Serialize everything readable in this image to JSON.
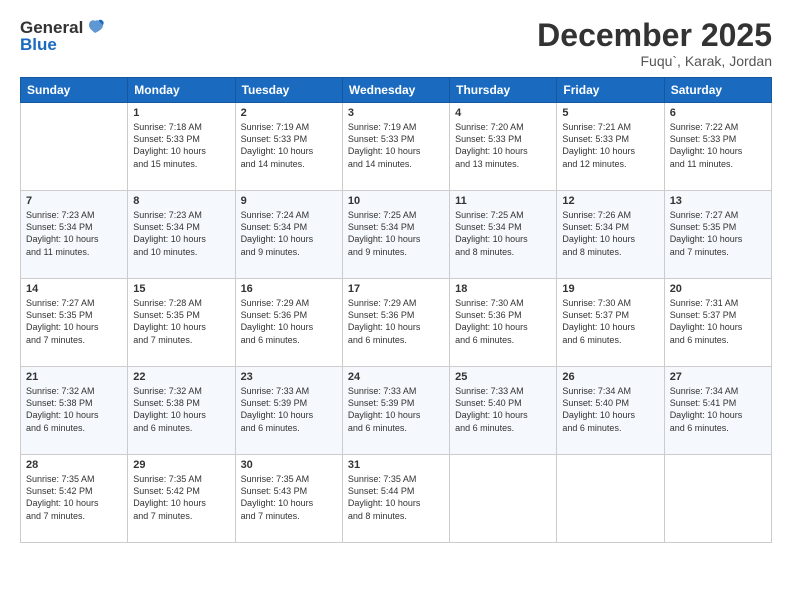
{
  "logo": {
    "line1": "General",
    "line2": "Blue"
  },
  "header": {
    "month": "December 2025",
    "location": "Fuqu`, Karak, Jordan"
  },
  "weekdays": [
    "Sunday",
    "Monday",
    "Tuesday",
    "Wednesday",
    "Thursday",
    "Friday",
    "Saturday"
  ],
  "weeks": [
    [
      {
        "day": "",
        "content": ""
      },
      {
        "day": "1",
        "content": "Sunrise: 7:18 AM\nSunset: 5:33 PM\nDaylight: 10 hours\nand 15 minutes."
      },
      {
        "day": "2",
        "content": "Sunrise: 7:19 AM\nSunset: 5:33 PM\nDaylight: 10 hours\nand 14 minutes."
      },
      {
        "day": "3",
        "content": "Sunrise: 7:19 AM\nSunset: 5:33 PM\nDaylight: 10 hours\nand 14 minutes."
      },
      {
        "day": "4",
        "content": "Sunrise: 7:20 AM\nSunset: 5:33 PM\nDaylight: 10 hours\nand 13 minutes."
      },
      {
        "day": "5",
        "content": "Sunrise: 7:21 AM\nSunset: 5:33 PM\nDaylight: 10 hours\nand 12 minutes."
      },
      {
        "day": "6",
        "content": "Sunrise: 7:22 AM\nSunset: 5:33 PM\nDaylight: 10 hours\nand 11 minutes."
      }
    ],
    [
      {
        "day": "7",
        "content": "Sunrise: 7:23 AM\nSunset: 5:34 PM\nDaylight: 10 hours\nand 11 minutes."
      },
      {
        "day": "8",
        "content": "Sunrise: 7:23 AM\nSunset: 5:34 PM\nDaylight: 10 hours\nand 10 minutes."
      },
      {
        "day": "9",
        "content": "Sunrise: 7:24 AM\nSunset: 5:34 PM\nDaylight: 10 hours\nand 9 minutes."
      },
      {
        "day": "10",
        "content": "Sunrise: 7:25 AM\nSunset: 5:34 PM\nDaylight: 10 hours\nand 9 minutes."
      },
      {
        "day": "11",
        "content": "Sunrise: 7:25 AM\nSunset: 5:34 PM\nDaylight: 10 hours\nand 8 minutes."
      },
      {
        "day": "12",
        "content": "Sunrise: 7:26 AM\nSunset: 5:34 PM\nDaylight: 10 hours\nand 8 minutes."
      },
      {
        "day": "13",
        "content": "Sunrise: 7:27 AM\nSunset: 5:35 PM\nDaylight: 10 hours\nand 7 minutes."
      }
    ],
    [
      {
        "day": "14",
        "content": "Sunrise: 7:27 AM\nSunset: 5:35 PM\nDaylight: 10 hours\nand 7 minutes."
      },
      {
        "day": "15",
        "content": "Sunrise: 7:28 AM\nSunset: 5:35 PM\nDaylight: 10 hours\nand 7 minutes."
      },
      {
        "day": "16",
        "content": "Sunrise: 7:29 AM\nSunset: 5:36 PM\nDaylight: 10 hours\nand 6 minutes."
      },
      {
        "day": "17",
        "content": "Sunrise: 7:29 AM\nSunset: 5:36 PM\nDaylight: 10 hours\nand 6 minutes."
      },
      {
        "day": "18",
        "content": "Sunrise: 7:30 AM\nSunset: 5:36 PM\nDaylight: 10 hours\nand 6 minutes."
      },
      {
        "day": "19",
        "content": "Sunrise: 7:30 AM\nSunset: 5:37 PM\nDaylight: 10 hours\nand 6 minutes."
      },
      {
        "day": "20",
        "content": "Sunrise: 7:31 AM\nSunset: 5:37 PM\nDaylight: 10 hours\nand 6 minutes."
      }
    ],
    [
      {
        "day": "21",
        "content": "Sunrise: 7:32 AM\nSunset: 5:38 PM\nDaylight: 10 hours\nand 6 minutes."
      },
      {
        "day": "22",
        "content": "Sunrise: 7:32 AM\nSunset: 5:38 PM\nDaylight: 10 hours\nand 6 minutes."
      },
      {
        "day": "23",
        "content": "Sunrise: 7:33 AM\nSunset: 5:39 PM\nDaylight: 10 hours\nand 6 minutes."
      },
      {
        "day": "24",
        "content": "Sunrise: 7:33 AM\nSunset: 5:39 PM\nDaylight: 10 hours\nand 6 minutes."
      },
      {
        "day": "25",
        "content": "Sunrise: 7:33 AM\nSunset: 5:40 PM\nDaylight: 10 hours\nand 6 minutes."
      },
      {
        "day": "26",
        "content": "Sunrise: 7:34 AM\nSunset: 5:40 PM\nDaylight: 10 hours\nand 6 minutes."
      },
      {
        "day": "27",
        "content": "Sunrise: 7:34 AM\nSunset: 5:41 PM\nDaylight: 10 hours\nand 6 minutes."
      }
    ],
    [
      {
        "day": "28",
        "content": "Sunrise: 7:35 AM\nSunset: 5:42 PM\nDaylight: 10 hours\nand 7 minutes."
      },
      {
        "day": "29",
        "content": "Sunrise: 7:35 AM\nSunset: 5:42 PM\nDaylight: 10 hours\nand 7 minutes."
      },
      {
        "day": "30",
        "content": "Sunrise: 7:35 AM\nSunset: 5:43 PM\nDaylight: 10 hours\nand 7 minutes."
      },
      {
        "day": "31",
        "content": "Sunrise: 7:35 AM\nSunset: 5:44 PM\nDaylight: 10 hours\nand 8 minutes."
      },
      {
        "day": "",
        "content": ""
      },
      {
        "day": "",
        "content": ""
      },
      {
        "day": "",
        "content": ""
      }
    ]
  ]
}
